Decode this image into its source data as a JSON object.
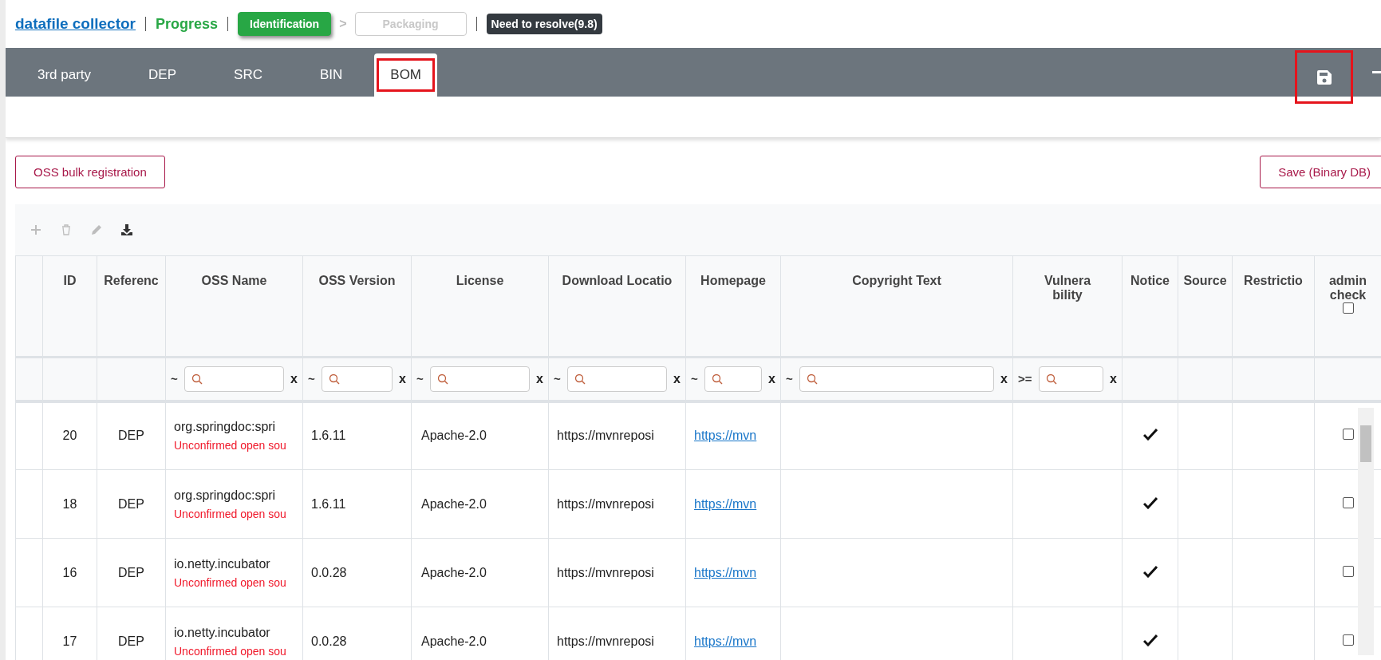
{
  "header": {
    "title": "datafile collector",
    "progress_label": "Progress",
    "steps": [
      {
        "label": "Identification",
        "selected": true
      },
      {
        "label": "Packaging",
        "selected": false
      }
    ],
    "step_separator": ">",
    "status_badge": "Need to resolve(9.8)"
  },
  "tabs": [
    {
      "label": "3rd party",
      "selected": false,
      "highlighted": false
    },
    {
      "label": "DEP",
      "selected": false,
      "highlighted": false
    },
    {
      "label": "SRC",
      "selected": false,
      "highlighted": false
    },
    {
      "label": "BIN",
      "selected": false,
      "highlighted": false
    },
    {
      "label": "BOM",
      "selected": true,
      "highlighted": true
    }
  ],
  "save_button": {
    "highlighted": true
  },
  "actions": {
    "bulk_registration": "OSS bulk registration",
    "save_binary": "Save (Binary DB)"
  },
  "toolbar": [
    {
      "kind": "add",
      "disabled": true
    },
    {
      "kind": "delete",
      "disabled": true
    },
    {
      "kind": "edit",
      "disabled": true
    },
    {
      "kind": "download",
      "disabled": false
    }
  ],
  "table": {
    "columns": [
      {
        "label": "ID"
      },
      {
        "label": "Referenc"
      },
      {
        "label": "OSS Name",
        "filter": {
          "operator": "~",
          "clear": "x"
        }
      },
      {
        "label": "OSS Version",
        "filter": {
          "operator": "~",
          "clear": "x"
        }
      },
      {
        "label": "License",
        "filter": {
          "operator": "~",
          "clear": "x"
        }
      },
      {
        "label": "Download Locatio",
        "filter": {
          "operator": "~",
          "clear": "x"
        }
      },
      {
        "label": "Homepage",
        "filter": {
          "operator": "~",
          "clear": "x"
        }
      },
      {
        "label": "Copyright Text",
        "filter": {
          "operator": "~",
          "clear": "x"
        }
      },
      {
        "label": "Vulnera\nbility",
        "filter": {
          "operator": ">=",
          "clear": "x"
        }
      },
      {
        "label": "Notice"
      },
      {
        "label": "Source"
      },
      {
        "label": "Restrictio"
      },
      {
        "label": "admin\ncheck",
        "checked": false
      }
    ],
    "rows": [
      {
        "id": "20",
        "reference": "DEP",
        "oss_name": "org.springdoc:spri",
        "warning": "Unconfirmed open sou",
        "version": "1.6.11",
        "license": "Apache-2.0",
        "download_location": "https://mvnreposi",
        "homepage": "https://mvn",
        "notice": true,
        "admin_checked": false
      },
      {
        "id": "18",
        "reference": "DEP",
        "oss_name": "org.springdoc:spri",
        "warning": "Unconfirmed open sou",
        "version": "1.6.11",
        "license": "Apache-2.0",
        "download_location": "https://mvnreposi",
        "homepage": "https://mvn",
        "notice": true,
        "admin_checked": false
      },
      {
        "id": "16",
        "reference": "DEP",
        "oss_name": "io.netty.incubator",
        "warning": "Unconfirmed open sou",
        "version": "0.0.28",
        "license": "Apache-2.0",
        "download_location": "https://mvnreposi",
        "homepage": "https://mvn",
        "notice": true,
        "admin_checked": false
      },
      {
        "id": "17",
        "reference": "DEP",
        "oss_name": "io.netty.incubator",
        "warning": "Unconfirmed open sou",
        "version": "0.0.28",
        "license": "Apache-2.0",
        "download_location": "https://mvnreposi",
        "homepage": "https://mvn",
        "notice": true,
        "admin_checked": false
      }
    ]
  }
}
